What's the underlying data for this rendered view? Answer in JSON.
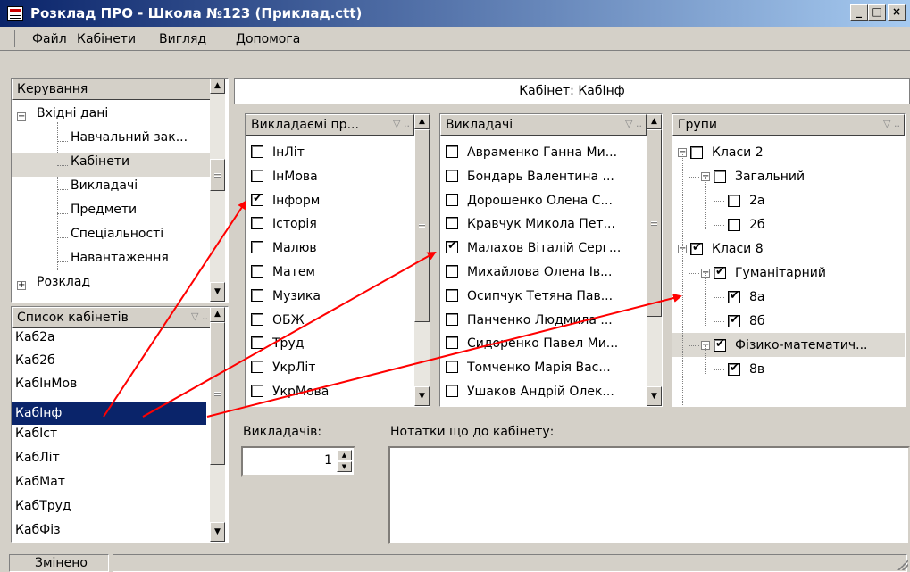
{
  "window": {
    "title": "Розклад ПРО - Школа №123 (Приклад.ctt)",
    "minimize": "_",
    "maximize": "□",
    "close": "×"
  },
  "menu": [
    "Файл",
    "Кабінети",
    "Вигляд",
    "Допомога"
  ],
  "control": {
    "header": "Керування",
    "tree": [
      {
        "label": "Вхідні дані",
        "expander": "−"
      },
      {
        "label": "Навчальний зак..."
      },
      {
        "label": "Кабінети"
      },
      {
        "label": "Викладачі"
      },
      {
        "label": "Предмети"
      },
      {
        "label": "Спеціальності"
      },
      {
        "label": "Навантаження"
      },
      {
        "label": "Розклад",
        "expander": "+"
      }
    ]
  },
  "rooms": {
    "header": "Список кабінетів",
    "items": [
      "Каб2а",
      "Каб2б",
      "КабІнМов",
      "КабІнф",
      "КабІст",
      "КабЛіт",
      "КабМат",
      "КабТруд",
      "КабФіз"
    ],
    "selected": "КабІнф"
  },
  "room_title": "Кабінет: КабІнф",
  "subjects": {
    "header": "Викладаємі пр...",
    "items": [
      {
        "label": "ІнЛіт",
        "checked": false
      },
      {
        "label": "ІнМова",
        "checked": false
      },
      {
        "label": "Інформ",
        "checked": true
      },
      {
        "label": "Історія",
        "checked": false
      },
      {
        "label": "Малюв",
        "checked": false
      },
      {
        "label": "Матем",
        "checked": false
      },
      {
        "label": "Музика",
        "checked": false
      },
      {
        "label": "ОБЖ",
        "checked": false
      },
      {
        "label": "Труд",
        "checked": false
      },
      {
        "label": "УкрЛіт",
        "checked": false
      },
      {
        "label": "УкрМова",
        "checked": false
      }
    ]
  },
  "teachers": {
    "header": "Викладачі",
    "items": [
      {
        "label": "Авраменко Ганна Ми...",
        "checked": false
      },
      {
        "label": "Бондарь Валентина ...",
        "checked": false
      },
      {
        "label": "Дорошенко Олена С...",
        "checked": false
      },
      {
        "label": "Кравчук Микола Пет...",
        "checked": false
      },
      {
        "label": "Малахов Віталій Серг...",
        "checked": true
      },
      {
        "label": "Михайлова Олена Ів...",
        "checked": false
      },
      {
        "label": "Осипчук Тетяна Пав...",
        "checked": false
      },
      {
        "label": "Панченко Людмила ...",
        "checked": false
      },
      {
        "label": "Сидоренко Павел Ми...",
        "checked": false
      },
      {
        "label": "Томченко Марія Вас...",
        "checked": false
      },
      {
        "label": "Ушаков Андрій Олек...",
        "checked": false
      }
    ]
  },
  "groups": {
    "header": "Групи",
    "items": [
      {
        "label": "Класи 2",
        "checked": false,
        "level": 0,
        "expander": "−"
      },
      {
        "label": "Загальний",
        "checked": false,
        "level": 1,
        "expander": "−"
      },
      {
        "label": "2а",
        "checked": false,
        "level": 2
      },
      {
        "label": "2б",
        "checked": false,
        "level": 2
      },
      {
        "label": "Класи 8",
        "checked": true,
        "level": 0,
        "expander": "−"
      },
      {
        "label": "Гуманітарний",
        "checked": true,
        "level": 1,
        "expander": "−"
      },
      {
        "label": "8а",
        "checked": true,
        "level": 2
      },
      {
        "label": "8б",
        "checked": true,
        "level": 2
      },
      {
        "label": "Фізико-математич...",
        "checked": true,
        "level": 1,
        "expander": "−"
      },
      {
        "label": "8в",
        "checked": true,
        "level": 2
      }
    ]
  },
  "teacher_count": {
    "label": "Викладачів:",
    "value": "1"
  },
  "notes": {
    "label": "Нотатки що до кабінету:",
    "value": ""
  },
  "status": {
    "text": "Змінено"
  },
  "colors": {
    "selection": "#0a246a",
    "arrow": "#ff0000",
    "face": "#d4d0c8"
  }
}
